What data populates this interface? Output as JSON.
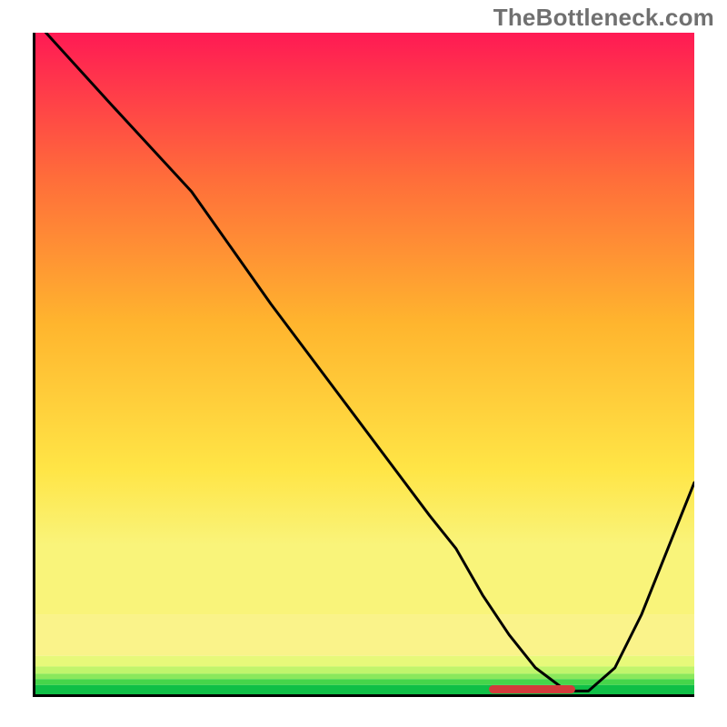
{
  "watermark": "TheBottleneck.com",
  "chart_data": {
    "type": "line",
    "title": "",
    "xlabel": "",
    "ylabel": "",
    "xlim": [
      0,
      100
    ],
    "ylim": [
      0,
      100
    ],
    "grid": false,
    "series": [
      {
        "name": "curve",
        "x": [
          2,
          12,
          24,
          36,
          48,
          60,
          64,
          68,
          72,
          76,
          80,
          82,
          84,
          88,
          92,
          96,
          100
        ],
        "values": [
          100,
          89,
          76,
          59,
          43,
          27,
          22,
          15,
          9,
          4,
          1,
          0.5,
          0.5,
          4,
          12,
          22,
          32
        ]
      }
    ],
    "bands": [
      {
        "name": "band-green-dark",
        "y0": 0.0,
        "y1": 1.4,
        "color": "#0fbf46"
      },
      {
        "name": "band-green",
        "y0": 1.4,
        "y1": 2.3,
        "color": "#46d54a"
      },
      {
        "name": "band-green-light",
        "y0": 2.3,
        "y1": 3.1,
        "color": "#8ae85c"
      },
      {
        "name": "band-lime",
        "y0": 3.1,
        "y1": 4.2,
        "color": "#c0f56c"
      },
      {
        "name": "band-pale-yellow",
        "y0": 4.2,
        "y1": 5.8,
        "color": "#e7f97a"
      },
      {
        "name": "band-cream",
        "y0": 5.8,
        "y1": 12.0,
        "color": "#faf38a"
      }
    ],
    "gradient": {
      "stops": [
        {
          "offset": 0,
          "color": "#ff1a54"
        },
        {
          "offset": 25,
          "color": "#ff6d3a"
        },
        {
          "offset": 50,
          "color": "#ffb52e"
        },
        {
          "offset": 75,
          "color": "#ffe546"
        },
        {
          "offset": 88,
          "color": "#f9f47a"
        }
      ]
    },
    "marker": {
      "x0": 69,
      "x1": 82,
      "y": 0.8,
      "color": "#d23b3b"
    }
  }
}
